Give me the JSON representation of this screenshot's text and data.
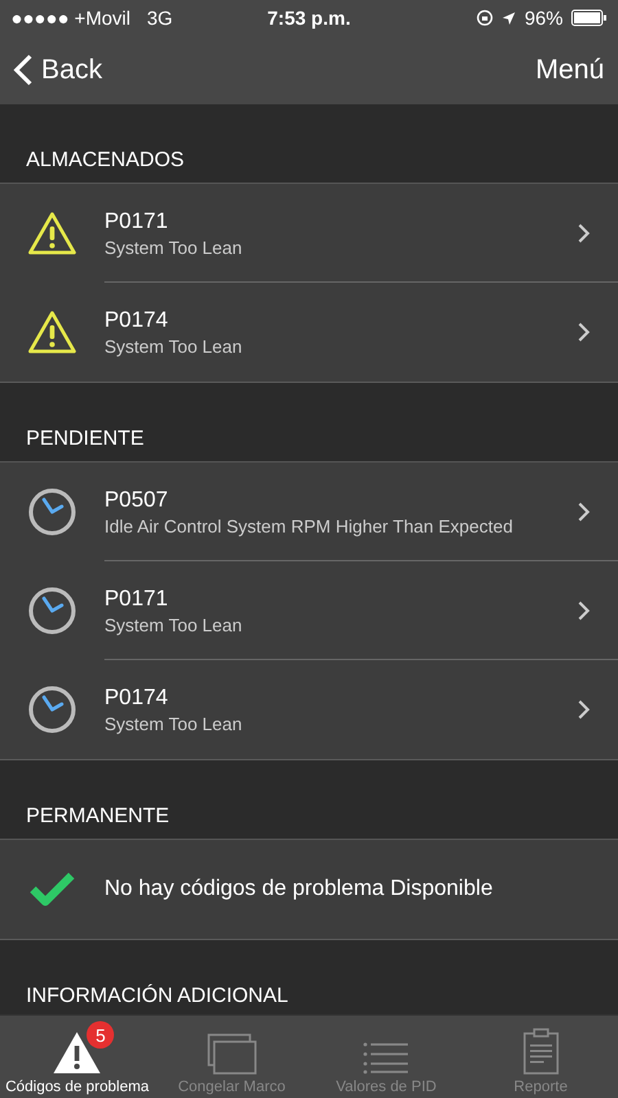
{
  "status_bar": {
    "carrier": "●●●●● +Movil",
    "network": "3G",
    "time": "7:53 p.m.",
    "battery": "96%"
  },
  "nav": {
    "back": "Back",
    "menu": "Menú"
  },
  "sections": [
    {
      "title": "ALMACENADOS",
      "rows": [
        {
          "kind": "warning",
          "code": "P0171",
          "description": "System Too Lean"
        },
        {
          "kind": "warning",
          "code": "P0174",
          "description": "System Too Lean"
        }
      ]
    },
    {
      "title": "PENDIENTE",
      "rows": [
        {
          "kind": "pending",
          "code": "P0507",
          "description": "Idle Air Control System RPM Higher Than Expected"
        },
        {
          "kind": "pending",
          "code": "P0171",
          "description": "System Too Lean"
        },
        {
          "kind": "pending",
          "code": "P0174",
          "description": "System Too Lean"
        }
      ]
    },
    {
      "title": "PERMANENTE",
      "rows": [
        {
          "kind": "ok",
          "message": "No hay códigos de problema Disponible"
        }
      ]
    },
    {
      "title": "INFORMACIÓN ADICIONAL"
    }
  ],
  "tabs": [
    {
      "kind": "warning",
      "label": "Códigos de problema",
      "selected": true,
      "badge": "5"
    },
    {
      "kind": "frames",
      "label": "Congelar Marco",
      "selected": false
    },
    {
      "kind": "list",
      "label": "Valores de PID",
      "selected": false
    },
    {
      "kind": "report",
      "label": "Reporte",
      "selected": false
    }
  ]
}
